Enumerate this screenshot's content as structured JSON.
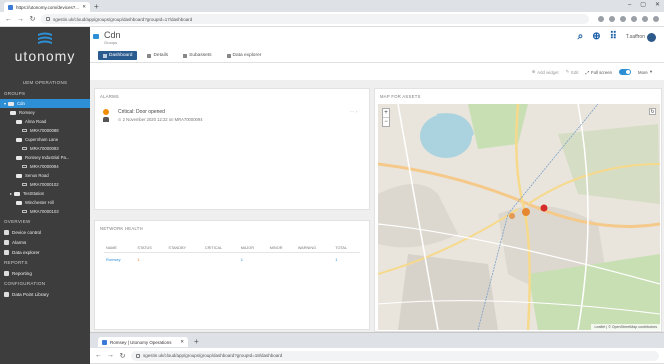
{
  "browser": {
    "tab_title": "https://utonomy.com/devices?...",
    "new_tab": "+",
    "url": "sgestin.uk/cloud/app/groups/group/dashboard?groupId=17/dashboard",
    "window_controls": [
      "–",
      "▢",
      "✕"
    ]
  },
  "sidebar": {
    "wordmark": "utonomy",
    "section_title": "UEM OPERATIONS",
    "groups_label": "GROUPS",
    "tree": [
      {
        "label": "Cdn",
        "kind": "folder",
        "indent": 0,
        "active": true,
        "caret": "▾"
      },
      {
        "label": "Romsey",
        "kind": "folder",
        "indent": 1
      },
      {
        "label": "Alma Road",
        "kind": "folder",
        "indent": 2
      },
      {
        "label": "MRA70000088",
        "kind": "device",
        "indent": 3
      },
      {
        "label": "Cupernham Lane",
        "kind": "folder",
        "indent": 2
      },
      {
        "label": "MRA70000093",
        "kind": "device",
        "indent": 3
      },
      {
        "label": "Romsey Industrial Pa...",
        "kind": "folder",
        "indent": 2
      },
      {
        "label": "MRA70000094",
        "kind": "device",
        "indent": 3
      },
      {
        "label": "Senus Road",
        "kind": "folder",
        "indent": 2
      },
      {
        "label": "MRA70000102",
        "kind": "device",
        "indent": 3
      },
      {
        "label": "TestStation",
        "kind": "folder",
        "indent": 1,
        "caret": "▸"
      },
      {
        "label": "Winchester Hill",
        "kind": "folder",
        "indent": 2
      },
      {
        "label": "MRA70000103",
        "kind": "device",
        "indent": 3
      }
    ],
    "overview_label": "OVERVIEW",
    "menu": [
      {
        "label": "Device control",
        "icon": "device-control-icon"
      },
      {
        "label": "Alarms",
        "icon": "bell-icon"
      },
      {
        "label": "Data explorer",
        "icon": "chart-icon"
      }
    ],
    "reports_label": "REPORTS",
    "reports": [
      {
        "label": "Reporting",
        "icon": "report-icon"
      }
    ],
    "config_label": "CONFIGURATION",
    "config": [
      {
        "label": "Data Point Library",
        "icon": "library-icon"
      }
    ]
  },
  "header": {
    "group_title": "Cdn",
    "group_subtitle": "Groups",
    "user_name": "T.saffron",
    "icons": [
      "search-icon",
      "add-icon",
      "apps-icon"
    ]
  },
  "tabs": [
    {
      "label": "Dashboard",
      "selected": true
    },
    {
      "label": "Details",
      "selected": false
    },
    {
      "label": "Subassets",
      "selected": false
    },
    {
      "label": "Data explorer",
      "selected": false
    }
  ],
  "toolbar": {
    "add_widget": "Add widget",
    "edit": "Edit",
    "full_screen": "Full screen",
    "more": "More"
  },
  "alarms_card": {
    "title": "ALARMS",
    "items": [
      {
        "title": "Critical: Door opened",
        "meta": "⊙ 2 November 2020 12:22   on MRA70000094"
      }
    ]
  },
  "network_card": {
    "title": "NETWORK HEALTH",
    "columns": [
      "NAME",
      "STATUS",
      "STANDBY",
      "CRITICAL",
      "MAJOR",
      "MINOR",
      "WARNING",
      "TOTAL"
    ],
    "rows": [
      {
        "name": "Romsey",
        "status": "1",
        "standby": "",
        "critical": "",
        "major": "1",
        "minor": "",
        "warning": "",
        "total": "1"
      }
    ]
  },
  "map_card": {
    "title": "MAP FOR ASSETS",
    "zoom_in": "+",
    "zoom_out": "−",
    "attribution": "Leaflet | © OpenStreetMap contributors"
  },
  "second_window": {
    "tab_title": "Romsey | Utonomy Operations",
    "url": "sgestin.uk/cloud/app/groups/group/dashboard?groupId=18/dashboard"
  },
  "colors": {
    "sidebar_bg": "#3d3d3d",
    "active": "#2d8fd5",
    "tab_selected": "#2a5b8f",
    "alarm_orange": "#f08c00",
    "header_icons": "#1c5fa8"
  }
}
